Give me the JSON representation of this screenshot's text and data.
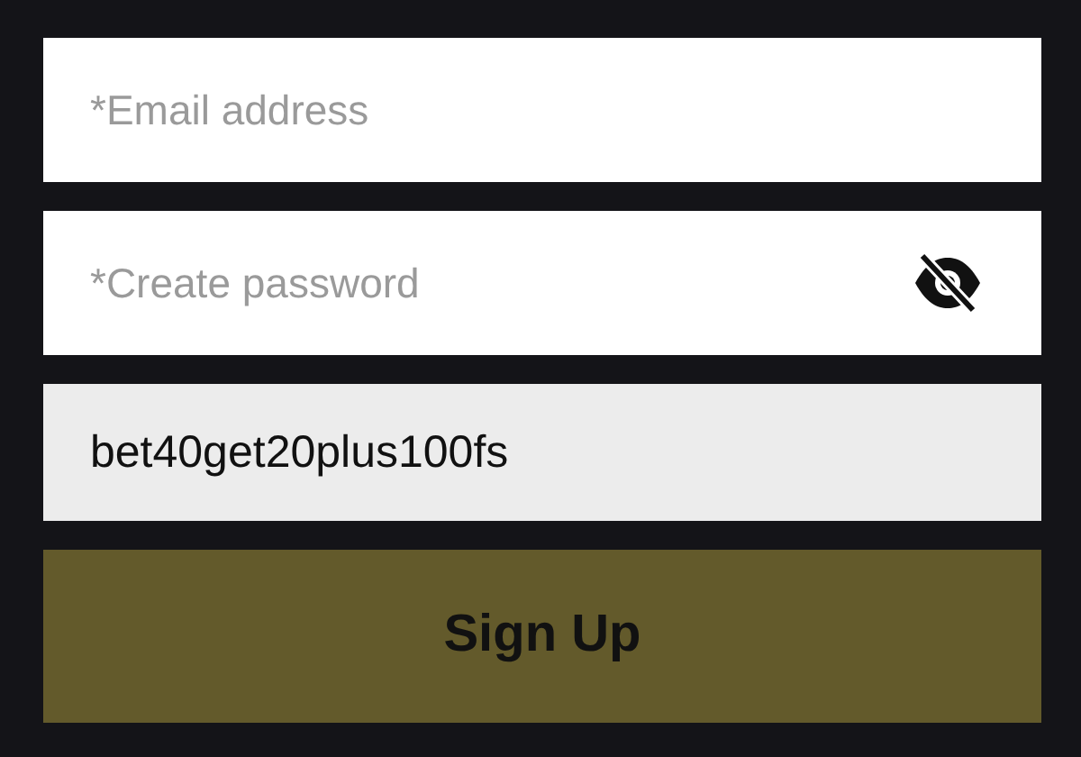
{
  "email_field": {
    "placeholder": "*Email address"
  },
  "password_field": {
    "placeholder": "*Create password"
  },
  "promo_code_field": {
    "value": "bet40get20plus100fs"
  },
  "sign_up_button": {
    "label": "Sign Up"
  }
}
